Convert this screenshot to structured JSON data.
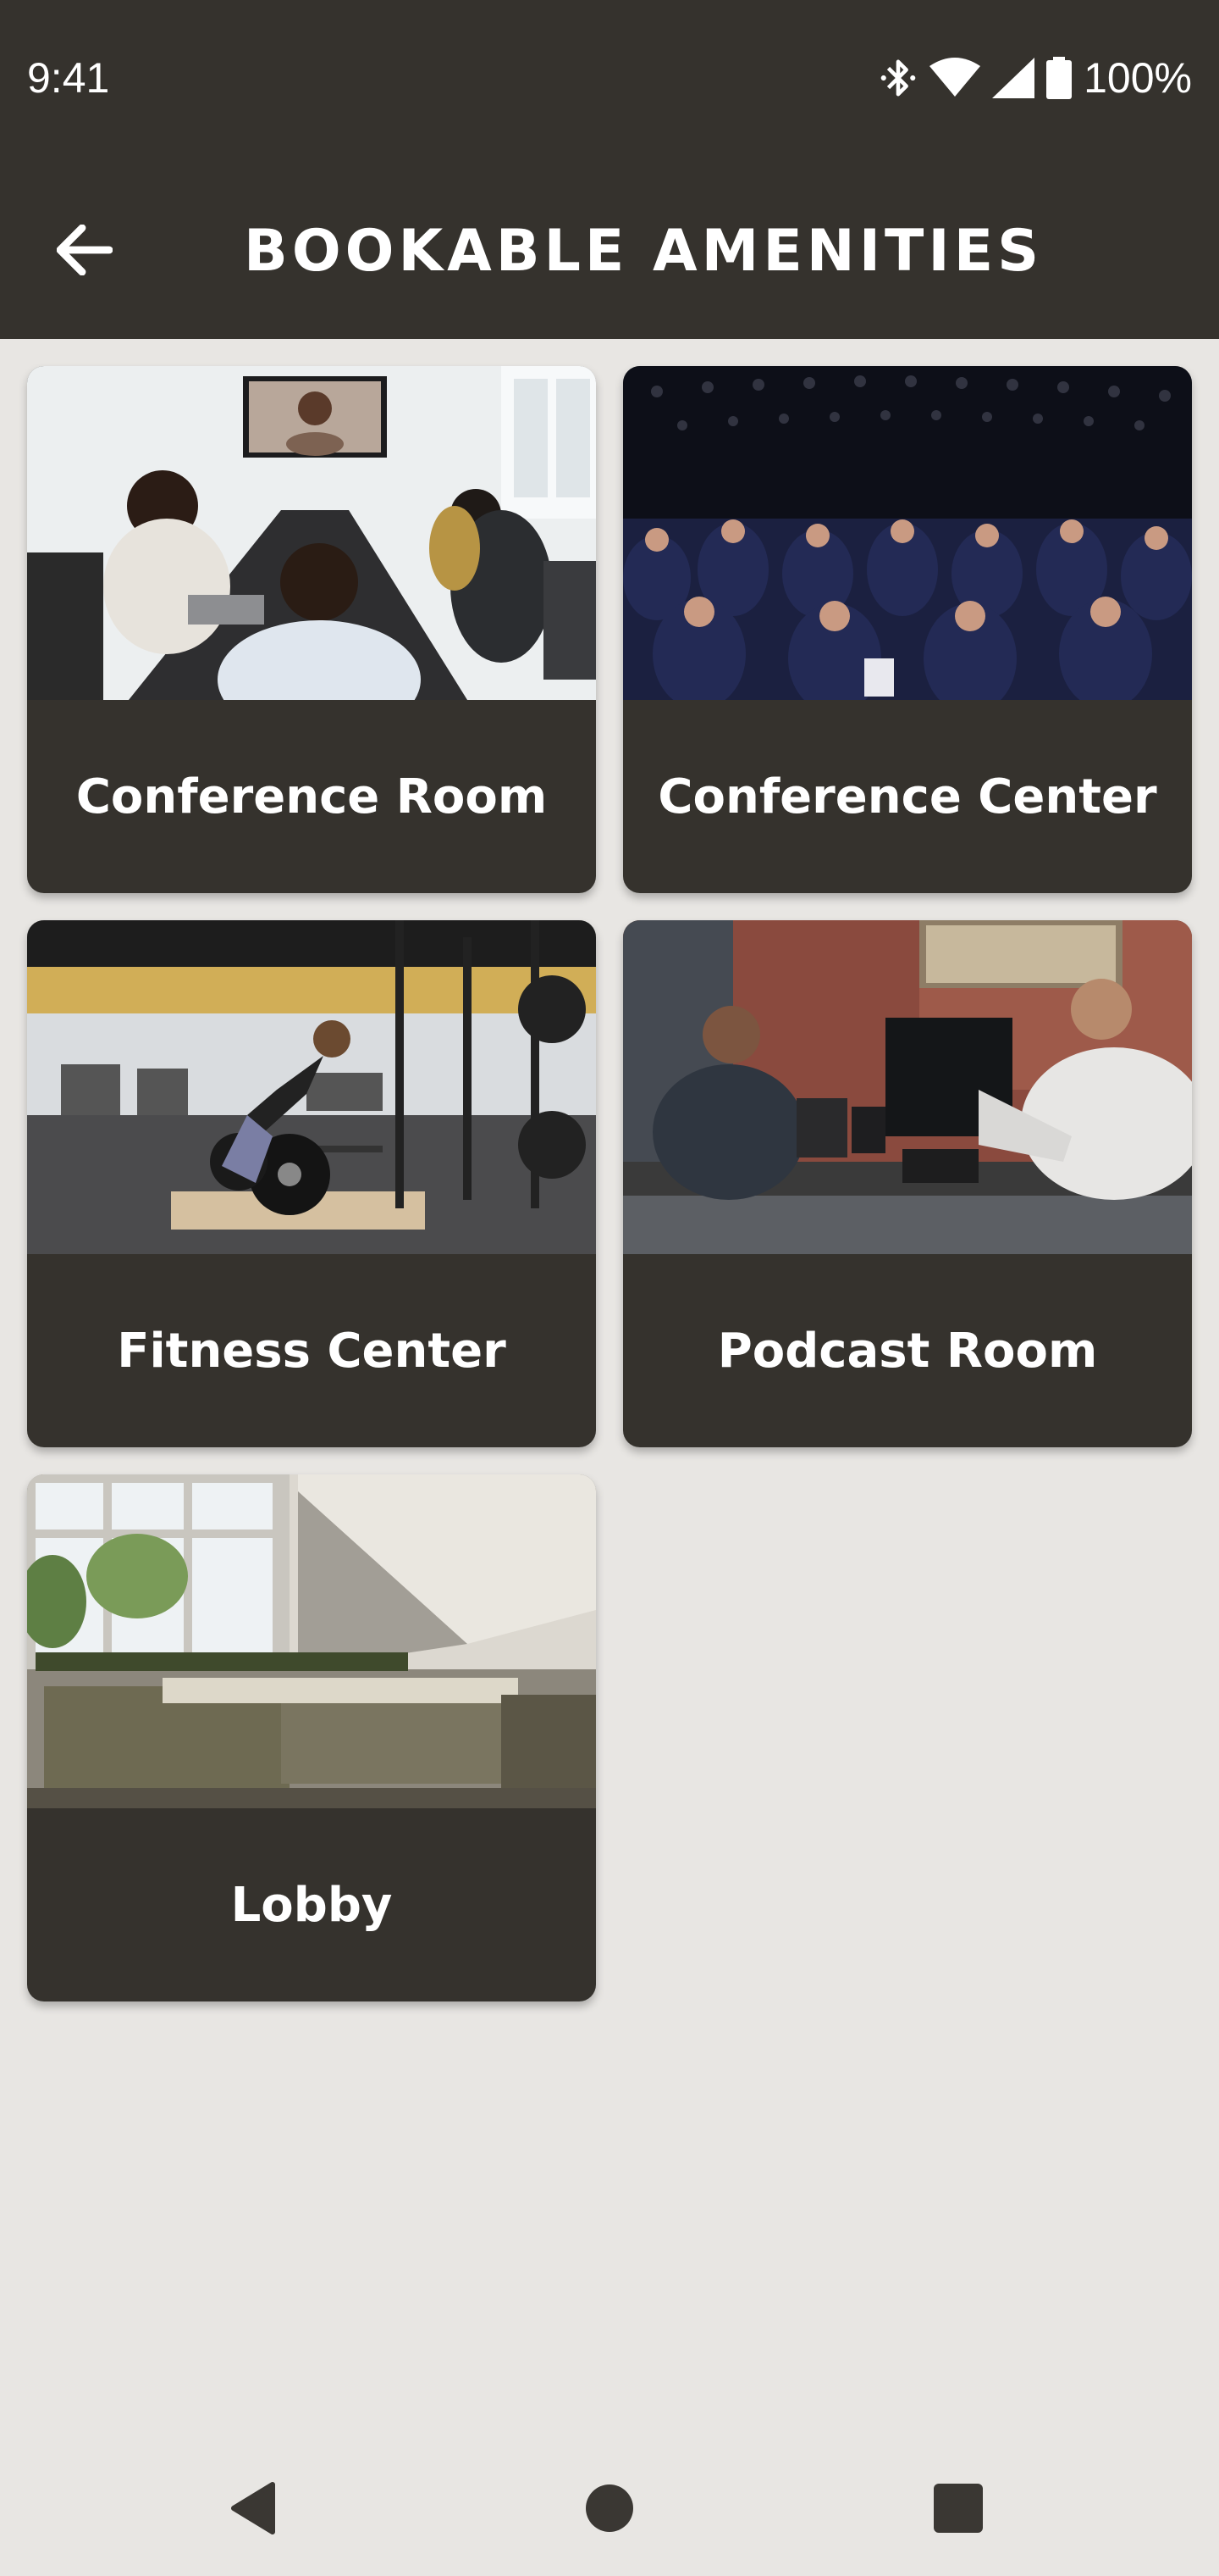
{
  "status_bar": {
    "time": "9:41",
    "battery_percent": "100%",
    "icons": [
      "bluetooth-icon",
      "wifi-icon",
      "signal-icon",
      "battery-icon"
    ]
  },
  "header": {
    "title": "BOOKABLE AMENITIES",
    "back_icon": "arrow-left-icon"
  },
  "amenities": [
    {
      "label": "Conference Room",
      "photo": "conference room with video call"
    },
    {
      "label": "Conference Center",
      "photo": "audience in auditorium"
    },
    {
      "label": "Fitness Center",
      "photo": "gym with weightlifter"
    },
    {
      "label": "Podcast Room",
      "photo": "two men recording podcast"
    },
    {
      "label": "Lobby",
      "photo": "lobby lounge with sofas"
    }
  ],
  "nav_bar": {
    "icons": [
      "back-triangle-icon",
      "home-circle-icon",
      "recents-square-icon"
    ]
  },
  "colors": {
    "bar": "#35322d",
    "background": "#e8e6e3",
    "card": "#35322d",
    "text_light": "#ffffff"
  }
}
